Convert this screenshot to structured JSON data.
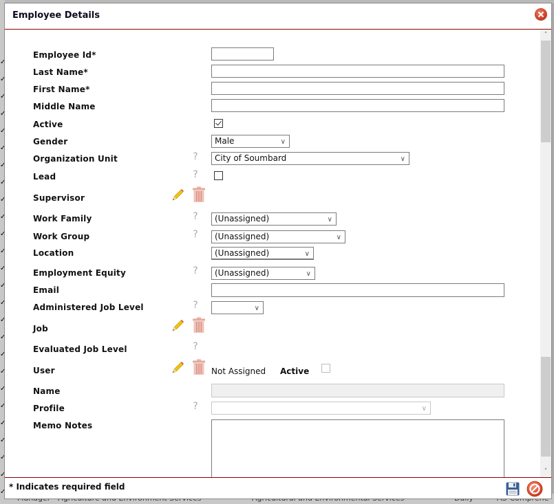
{
  "dialog": {
    "title": "Employee Details",
    "footer_note": "* Indicates required field"
  },
  "fields": {
    "employee_id": {
      "label": "Employee Id*",
      "value": ""
    },
    "last_name": {
      "label": "Last Name*",
      "value": ""
    },
    "first_name": {
      "label": "First Name*",
      "value": ""
    },
    "middle_name": {
      "label": "Middle Name",
      "value": ""
    },
    "active": {
      "label": "Active",
      "checked": true
    },
    "gender": {
      "label": "Gender",
      "value": "Male"
    },
    "organization_unit": {
      "label": "Organization Unit",
      "value": "City of Soumbard"
    },
    "lead": {
      "label": "Lead",
      "checked": false
    },
    "supervisor": {
      "label": "Supervisor"
    },
    "work_family": {
      "label": "Work Family",
      "value": "(Unassigned)"
    },
    "work_group": {
      "label": "Work Group",
      "value": "(Unassigned)"
    },
    "location": {
      "label": "Location",
      "value": "(Unassigned)"
    },
    "employment_equity": {
      "label": "Employment Equity",
      "value": "(Unassigned)"
    },
    "email": {
      "label": "Email",
      "value": ""
    },
    "administered_job_level": {
      "label": "Administered Job Level",
      "value": ""
    },
    "job": {
      "label": "Job"
    },
    "evaluated_job_level": {
      "label": "Evaluated Job Level"
    },
    "user": {
      "label": "User",
      "status": "Not Assigned",
      "active_label": "Active",
      "active_checked": false
    },
    "name": {
      "label": "Name",
      "value": ""
    },
    "profile": {
      "label": "Profile",
      "value": ""
    },
    "memo_notes": {
      "label": "Memo Notes",
      "value": ""
    }
  },
  "icons": {
    "help": "?",
    "chevron": "∨",
    "scroll_up": "˄",
    "scroll_down": "˅"
  },
  "background": {
    "bottom_cells": [
      "Manager - Agriculture and Environment Services",
      "Agricultural and Environmental Services",
      "Daily",
      "AS-Comprehe"
    ]
  }
}
